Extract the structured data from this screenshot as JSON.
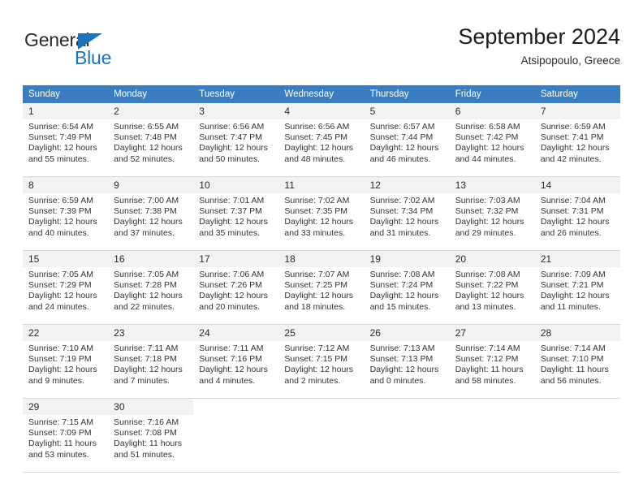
{
  "logo": {
    "word_one": "General",
    "word_two": "Blue",
    "triangle_color": "#1b74bb"
  },
  "header": {
    "month_title": "September 2024",
    "location": "Atsipopoulo, Greece"
  },
  "theme": {
    "header_blue": "#3a7dc0",
    "daynum_gray": "#f2f2f2",
    "grid_line": "#d8d8d8"
  },
  "weekdays": [
    "Sunday",
    "Monday",
    "Tuesday",
    "Wednesday",
    "Thursday",
    "Friday",
    "Saturday"
  ],
  "weeks": [
    [
      {
        "day": "1",
        "sunrise": "Sunrise: 6:54 AM",
        "sunset": "Sunset: 7:49 PM",
        "daylight_1": "Daylight: 12 hours",
        "daylight_2": "and 55 minutes."
      },
      {
        "day": "2",
        "sunrise": "Sunrise: 6:55 AM",
        "sunset": "Sunset: 7:48 PM",
        "daylight_1": "Daylight: 12 hours",
        "daylight_2": "and 52 minutes."
      },
      {
        "day": "3",
        "sunrise": "Sunrise: 6:56 AM",
        "sunset": "Sunset: 7:47 PM",
        "daylight_1": "Daylight: 12 hours",
        "daylight_2": "and 50 minutes."
      },
      {
        "day": "4",
        "sunrise": "Sunrise: 6:56 AM",
        "sunset": "Sunset: 7:45 PM",
        "daylight_1": "Daylight: 12 hours",
        "daylight_2": "and 48 minutes."
      },
      {
        "day": "5",
        "sunrise": "Sunrise: 6:57 AM",
        "sunset": "Sunset: 7:44 PM",
        "daylight_1": "Daylight: 12 hours",
        "daylight_2": "and 46 minutes."
      },
      {
        "day": "6",
        "sunrise": "Sunrise: 6:58 AM",
        "sunset": "Sunset: 7:42 PM",
        "daylight_1": "Daylight: 12 hours",
        "daylight_2": "and 44 minutes."
      },
      {
        "day": "7",
        "sunrise": "Sunrise: 6:59 AM",
        "sunset": "Sunset: 7:41 PM",
        "daylight_1": "Daylight: 12 hours",
        "daylight_2": "and 42 minutes."
      }
    ],
    [
      {
        "day": "8",
        "sunrise": "Sunrise: 6:59 AM",
        "sunset": "Sunset: 7:39 PM",
        "daylight_1": "Daylight: 12 hours",
        "daylight_2": "and 40 minutes."
      },
      {
        "day": "9",
        "sunrise": "Sunrise: 7:00 AM",
        "sunset": "Sunset: 7:38 PM",
        "daylight_1": "Daylight: 12 hours",
        "daylight_2": "and 37 minutes."
      },
      {
        "day": "10",
        "sunrise": "Sunrise: 7:01 AM",
        "sunset": "Sunset: 7:37 PM",
        "daylight_1": "Daylight: 12 hours",
        "daylight_2": "and 35 minutes."
      },
      {
        "day": "11",
        "sunrise": "Sunrise: 7:02 AM",
        "sunset": "Sunset: 7:35 PM",
        "daylight_1": "Daylight: 12 hours",
        "daylight_2": "and 33 minutes."
      },
      {
        "day": "12",
        "sunrise": "Sunrise: 7:02 AM",
        "sunset": "Sunset: 7:34 PM",
        "daylight_1": "Daylight: 12 hours",
        "daylight_2": "and 31 minutes."
      },
      {
        "day": "13",
        "sunrise": "Sunrise: 7:03 AM",
        "sunset": "Sunset: 7:32 PM",
        "daylight_1": "Daylight: 12 hours",
        "daylight_2": "and 29 minutes."
      },
      {
        "day": "14",
        "sunrise": "Sunrise: 7:04 AM",
        "sunset": "Sunset: 7:31 PM",
        "daylight_1": "Daylight: 12 hours",
        "daylight_2": "and 26 minutes."
      }
    ],
    [
      {
        "day": "15",
        "sunrise": "Sunrise: 7:05 AM",
        "sunset": "Sunset: 7:29 PM",
        "daylight_1": "Daylight: 12 hours",
        "daylight_2": "and 24 minutes."
      },
      {
        "day": "16",
        "sunrise": "Sunrise: 7:05 AM",
        "sunset": "Sunset: 7:28 PM",
        "daylight_1": "Daylight: 12 hours",
        "daylight_2": "and 22 minutes."
      },
      {
        "day": "17",
        "sunrise": "Sunrise: 7:06 AM",
        "sunset": "Sunset: 7:26 PM",
        "daylight_1": "Daylight: 12 hours",
        "daylight_2": "and 20 minutes."
      },
      {
        "day": "18",
        "sunrise": "Sunrise: 7:07 AM",
        "sunset": "Sunset: 7:25 PM",
        "daylight_1": "Daylight: 12 hours",
        "daylight_2": "and 18 minutes."
      },
      {
        "day": "19",
        "sunrise": "Sunrise: 7:08 AM",
        "sunset": "Sunset: 7:24 PM",
        "daylight_1": "Daylight: 12 hours",
        "daylight_2": "and 15 minutes."
      },
      {
        "day": "20",
        "sunrise": "Sunrise: 7:08 AM",
        "sunset": "Sunset: 7:22 PM",
        "daylight_1": "Daylight: 12 hours",
        "daylight_2": "and 13 minutes."
      },
      {
        "day": "21",
        "sunrise": "Sunrise: 7:09 AM",
        "sunset": "Sunset: 7:21 PM",
        "daylight_1": "Daylight: 12 hours",
        "daylight_2": "and 11 minutes."
      }
    ],
    [
      {
        "day": "22",
        "sunrise": "Sunrise: 7:10 AM",
        "sunset": "Sunset: 7:19 PM",
        "daylight_1": "Daylight: 12 hours",
        "daylight_2": "and 9 minutes."
      },
      {
        "day": "23",
        "sunrise": "Sunrise: 7:11 AM",
        "sunset": "Sunset: 7:18 PM",
        "daylight_1": "Daylight: 12 hours",
        "daylight_2": "and 7 minutes."
      },
      {
        "day": "24",
        "sunrise": "Sunrise: 7:11 AM",
        "sunset": "Sunset: 7:16 PM",
        "daylight_1": "Daylight: 12 hours",
        "daylight_2": "and 4 minutes."
      },
      {
        "day": "25",
        "sunrise": "Sunrise: 7:12 AM",
        "sunset": "Sunset: 7:15 PM",
        "daylight_1": "Daylight: 12 hours",
        "daylight_2": "and 2 minutes."
      },
      {
        "day": "26",
        "sunrise": "Sunrise: 7:13 AM",
        "sunset": "Sunset: 7:13 PM",
        "daylight_1": "Daylight: 12 hours",
        "daylight_2": "and 0 minutes."
      },
      {
        "day": "27",
        "sunrise": "Sunrise: 7:14 AM",
        "sunset": "Sunset: 7:12 PM",
        "daylight_1": "Daylight: 11 hours",
        "daylight_2": "and 58 minutes."
      },
      {
        "day": "28",
        "sunrise": "Sunrise: 7:14 AM",
        "sunset": "Sunset: 7:10 PM",
        "daylight_1": "Daylight: 11 hours",
        "daylight_2": "and 56 minutes."
      }
    ],
    [
      {
        "day": "29",
        "sunrise": "Sunrise: 7:15 AM",
        "sunset": "Sunset: 7:09 PM",
        "daylight_1": "Daylight: 11 hours",
        "daylight_2": "and 53 minutes."
      },
      {
        "day": "30",
        "sunrise": "Sunrise: 7:16 AM",
        "sunset": "Sunset: 7:08 PM",
        "daylight_1": "Daylight: 11 hours",
        "daylight_2": "and 51 minutes."
      },
      null,
      null,
      null,
      null,
      null
    ]
  ]
}
